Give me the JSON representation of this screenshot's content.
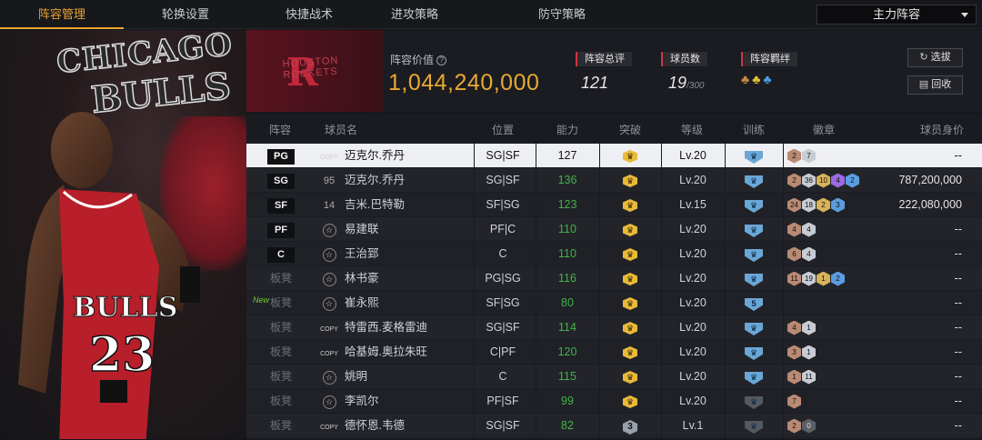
{
  "nav": {
    "tabs": [
      "阵容管理",
      "轮换设置",
      "快捷战术",
      "进攻策略",
      "防守策略"
    ],
    "dropdown": "主力阵容"
  },
  "banner": {
    "chicago": "CHICAGO",
    "bulls": "BULLS",
    "jersey_team": "BULLS",
    "jersey_number": "23"
  },
  "team": {
    "logo_text": "HOUSTON ROCKETS",
    "logo_letter": "R",
    "logo_color": "#c0283c",
    "value_label": "阵容价值",
    "value": "1,044,240,000",
    "rating_label": "阵容总评",
    "rating": "121",
    "players_label": "球员数",
    "players": "19",
    "players_max": "/300",
    "bond_label": "阵容羁绊"
  },
  "buttons": {
    "select": "选拔",
    "recycle": "回收"
  },
  "table": {
    "headers": [
      "阵容",
      "球员名",
      "位置",
      "能力",
      "突破",
      "等级",
      "训练",
      "徽章",
      "球员身价"
    ],
    "rows": [
      {
        "slot": "PG",
        "bench": false,
        "icon": "copy",
        "name": "迈克尔.乔丹",
        "pos": "SG|SF",
        "ability": "127",
        "ability_green": false,
        "breakthrough": "crown",
        "level": "Lv.20",
        "train": "crown",
        "badges": [
          [
            "b",
            "2"
          ],
          [
            "s",
            "7"
          ]
        ],
        "worth": "--",
        "selected": true
      },
      {
        "slot": "SG",
        "bench": false,
        "icon": "95",
        "name": "迈克尔.乔丹",
        "pos": "SG|SF",
        "ability": "136",
        "ability_green": true,
        "breakthrough": "crown",
        "level": "Lv.20",
        "train": "crown",
        "badges": [
          [
            "b",
            "2"
          ],
          [
            "s",
            "36"
          ],
          [
            "g",
            "10"
          ],
          [
            "p",
            "4"
          ],
          [
            "bl",
            "2"
          ]
        ],
        "worth": "787,200,000"
      },
      {
        "slot": "SF",
        "bench": false,
        "icon": "14",
        "name": "吉米.巴特勒",
        "pos": "SF|SG",
        "ability": "123",
        "ability_green": true,
        "breakthrough": "crown",
        "level": "Lv.15",
        "train": "crown",
        "badges": [
          [
            "b",
            "24"
          ],
          [
            "s",
            "18"
          ],
          [
            "g",
            "2"
          ],
          [
            "bl",
            "3"
          ]
        ],
        "worth": "222,080,000"
      },
      {
        "slot": "PF",
        "bench": false,
        "icon": "star",
        "name": "易建联",
        "pos": "PF|C",
        "ability": "110",
        "ability_green": true,
        "breakthrough": "crown",
        "level": "Lv.20",
        "train": "crown",
        "badges": [
          [
            "b",
            "4"
          ],
          [
            "s",
            "4"
          ]
        ],
        "worth": "--"
      },
      {
        "slot": "C",
        "bench": false,
        "icon": "star",
        "name": "王治郅",
        "pos": "C",
        "ability": "110",
        "ability_green": true,
        "breakthrough": "crown",
        "level": "Lv.20",
        "train": "crown",
        "badges": [
          [
            "b",
            "6"
          ],
          [
            "s",
            "4"
          ]
        ],
        "worth": "--"
      },
      {
        "slot": "板凳",
        "bench": true,
        "icon": "star",
        "name": "林书豪",
        "pos": "PG|SG",
        "ability": "116",
        "ability_green": true,
        "breakthrough": "crown",
        "level": "Lv.20",
        "train": "crown",
        "badges": [
          [
            "b",
            "11"
          ],
          [
            "s",
            "19"
          ],
          [
            "g",
            "1"
          ],
          [
            "bl",
            "2"
          ]
        ],
        "worth": "--"
      },
      {
        "slot": "板凳",
        "bench": true,
        "new": "New",
        "icon": "star",
        "name": "崔永熙",
        "pos": "SF|SG",
        "ability": "80",
        "ability_green": true,
        "breakthrough": "crown",
        "level": "Lv.20",
        "train": "5",
        "badges": [],
        "worth": "--"
      },
      {
        "slot": "板凳",
        "bench": true,
        "icon": "copy",
        "name": "特雷西.麦格雷迪",
        "pos": "SG|SF",
        "ability": "114",
        "ability_green": true,
        "breakthrough": "crown",
        "level": "Lv.20",
        "train": "crown",
        "badges": [
          [
            "b",
            "4"
          ],
          [
            "s",
            "1"
          ]
        ],
        "worth": "--"
      },
      {
        "slot": "板凳",
        "bench": true,
        "icon": "copy",
        "name": "哈基姆.奥拉朱旺",
        "pos": "C|PF",
        "ability": "120",
        "ability_green": true,
        "breakthrough": "crown",
        "level": "Lv.20",
        "train": "crown",
        "badges": [
          [
            "b",
            "3"
          ],
          [
            "s",
            "1"
          ]
        ],
        "worth": "--"
      },
      {
        "slot": "板凳",
        "bench": true,
        "icon": "star",
        "name": "姚明",
        "pos": "C",
        "ability": "115",
        "ability_green": true,
        "breakthrough": "crown",
        "level": "Lv.20",
        "train": "crown",
        "badges": [
          [
            "b",
            "1"
          ],
          [
            "s",
            "11"
          ]
        ],
        "worth": "--"
      },
      {
        "slot": "板凳",
        "bench": true,
        "icon": "star",
        "name": "李凯尔",
        "pos": "PF|SF",
        "ability": "99",
        "ability_green": true,
        "breakthrough": "crown",
        "level": "Lv.20",
        "train": "gray",
        "badges": [
          [
            "b",
            "7"
          ]
        ],
        "worth": "--"
      },
      {
        "slot": "板凳",
        "bench": true,
        "icon": "copy",
        "name": "德怀恩.韦德",
        "pos": "SG|SF",
        "ability": "82",
        "ability_green": true,
        "breakthrough": "3",
        "level": "Lv.1",
        "train": "gray",
        "badges": [
          [
            "b",
            "2"
          ],
          [
            "d",
            "0"
          ]
        ],
        "worth": "--"
      }
    ]
  },
  "icons": {
    "copy": "COPY",
    "star": "☆",
    "crown": "♛",
    "help": "?",
    "refresh": "↻",
    "recycle": "▤"
  }
}
